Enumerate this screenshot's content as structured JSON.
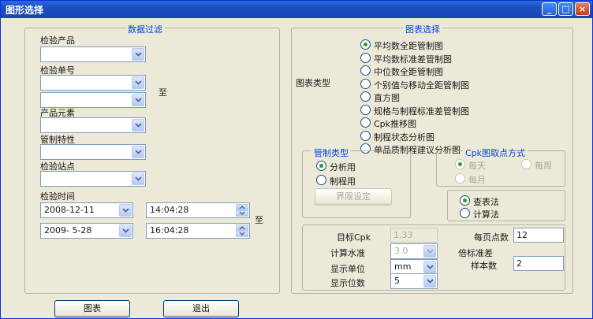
{
  "window": {
    "title": "图形选择"
  },
  "filter": {
    "legend": "数据过滤",
    "product_label": "检验产品",
    "product_value": "",
    "order_label": "检验单号",
    "order_from": "",
    "order_to": "",
    "to_label": "至",
    "element_label": "产品元素",
    "element_value": "",
    "control_char_label": "管制特性",
    "control_char_value": "",
    "station_label": "检验站点",
    "station_value": "",
    "time_label": "检验时间",
    "start_date": "2008-12-11",
    "start_time": "14:04:28",
    "end_date": "2009- 5-28",
    "end_time": "16:04:28",
    "time_to_label": "至"
  },
  "chart_select": {
    "legend": "图表选择",
    "type_label": "图表类型",
    "options": [
      "平均数全距管制图",
      "平均数标准差管制图",
      "中位数全距管制图",
      "个别值与移动全距管制图",
      "直方图",
      "规格与制程标准差管制图",
      "Cpk推移图",
      "制程状态分析图",
      "单品质制程建议分析图"
    ],
    "selected_index": 0
  },
  "control_type": {
    "legend": "管制类型",
    "analysis": "分析用",
    "process": "制程用",
    "limit_button": "界限设定"
  },
  "cpk_point": {
    "legend": "Cpk图取点方式",
    "daily": "每天",
    "weekly": "每周",
    "monthly": "每月",
    "lookup": "查表法",
    "compute": "计算法"
  },
  "params": {
    "target_cpk_label": "目标Cpk",
    "target_cpk": "1.33",
    "points_per_page_label": "每页点数",
    "points_per_page": "12",
    "calc_level_label": "计算水准",
    "calc_level": "3.0",
    "std_multiplier_label": "倍标准差",
    "display_unit_label": "显示单位",
    "display_unit": "mm",
    "sample_size_label": "样本数",
    "sample_size": "2",
    "display_digits_label": "显示位数",
    "display_digits": "5"
  },
  "footer": {
    "chart_button": "图表",
    "exit_button": "退出"
  }
}
